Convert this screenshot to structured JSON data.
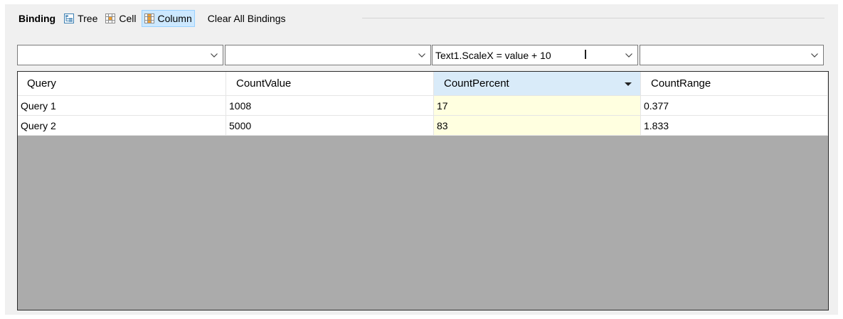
{
  "toolbar": {
    "title": "Binding",
    "buttons": [
      {
        "label": "Tree",
        "icon": "tree-icon",
        "active": false
      },
      {
        "label": "Cell",
        "icon": "cell-grid-icon",
        "active": false
      },
      {
        "label": "Column",
        "icon": "column-grid-icon",
        "active": true
      }
    ],
    "clear_label": "Clear All Bindings"
  },
  "bindings": [
    {
      "value": ""
    },
    {
      "value": ""
    },
    {
      "value": "Text1.ScaleX = value + 10"
    },
    {
      "value": ""
    }
  ],
  "grid": {
    "columns": [
      "Query",
      "CountValue",
      "CountPercent",
      "CountRange"
    ],
    "selected_column": "CountPercent",
    "rows": [
      [
        "Query 1",
        "1008",
        "17",
        "0.377"
      ],
      [
        "Query 2",
        "5000",
        "83",
        "1.833"
      ]
    ]
  },
  "colors": {
    "active_button_bg": "#cce8ff",
    "selected_header_bg": "#d9ebf9",
    "highlight_cell_bg": "#ffffe0",
    "empty_area": "#ababab"
  }
}
